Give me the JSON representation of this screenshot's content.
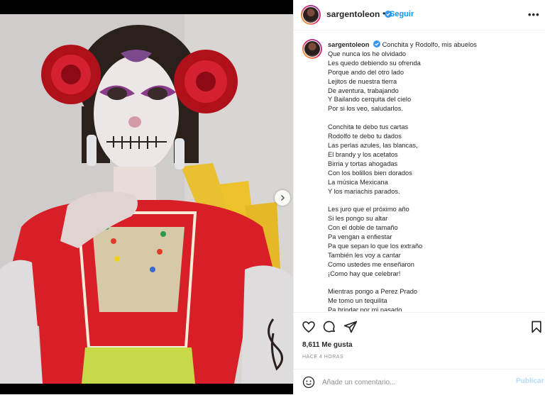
{
  "post": {
    "username": "sargentoleon",
    "follow_label": "Seguir",
    "separator": "•",
    "more_label": "•••",
    "caption_text": "Conchita y Rodolfo, mis abuelos\nQue nunca los he olvidado\nLes quedo debiendo su ofrenda\nPorque ando del otro lado\nLejitos de nuestra tierra\nDe aventura, trabajando\nY Bailando cerquita del cielo\nPor si los veo, saludarlos.\n\nConchita te debo tus cartas\nRodolfo te debo tu dados\nLas perlas azules, las blancas,\nEl brandy y los acetatos\nBirria y tortas ahogadas\nCon los bolillos bien dorados\nLa música Mexicana\nY los mariachis parados.\n\nLes juro que el próximo año\nSi les pongo su altar\nCon el doble de tamaño\nPa vengan a enfiestar\nPa que sepan lo que los extraño\nTambién les voy a cantar\nComo ustedes me enseñaron\n¡Como hay que celebrar!\n\nMientras pongo a Perez Prado\nMe tomo un tequilita\nPa brindar por mi pasado",
    "likes_text": "8,611 Me gusta",
    "time_text": "HACE 4 HORAS",
    "comment_placeholder": "Añade un comentario...",
    "publish_label": "Publicar"
  },
  "icons": {
    "verified": "verified-badge-icon",
    "like": "heart-icon",
    "comment": "comment-bubble-icon",
    "share": "paper-plane-icon",
    "save": "bookmark-icon",
    "emoji": "smiley-icon",
    "next": "chevron-right-icon"
  },
  "colors": {
    "accent": "#0095f6",
    "publish_disabled": "#b3dbff",
    "muted": "#8e8e8e"
  }
}
